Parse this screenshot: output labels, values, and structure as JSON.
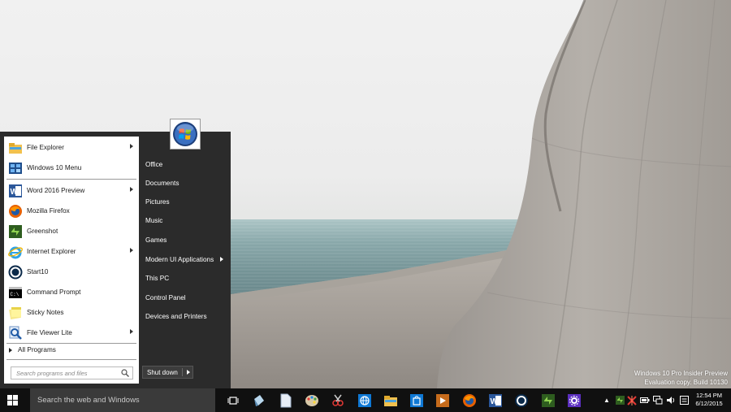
{
  "start_menu": {
    "pinned": [
      {
        "label": "File Explorer",
        "icon": "folder-icon",
        "has_submenu": true
      },
      {
        "label": "Windows 10 Menu",
        "icon": "app-grid-icon",
        "has_submenu": false
      },
      {
        "label": "Word 2016 Preview",
        "icon": "word-icon",
        "has_submenu": true
      },
      {
        "label": "Mozilla Firefox",
        "icon": "firefox-icon",
        "has_submenu": false
      },
      {
        "label": "Greenshot",
        "icon": "greenshot-icon",
        "has_submenu": false
      },
      {
        "label": "Internet Explorer",
        "icon": "ie-icon",
        "has_submenu": true
      },
      {
        "label": "Start10",
        "icon": "start10-icon",
        "has_submenu": false
      },
      {
        "label": "Command Prompt",
        "icon": "cmd-icon",
        "has_submenu": false
      },
      {
        "label": "Sticky Notes",
        "icon": "sticky-notes-icon",
        "has_submenu": false
      },
      {
        "label": "File Viewer Lite",
        "icon": "file-viewer-icon",
        "has_submenu": true
      }
    ],
    "all_programs": "All Programs",
    "search_placeholder": "Search programs and files",
    "right_items": [
      {
        "label": "Office"
      },
      {
        "label": "Documents"
      },
      {
        "label": "Pictures"
      },
      {
        "label": "Music"
      },
      {
        "label": "Games"
      },
      {
        "label": "Modern UI Applications",
        "has_submenu": true
      },
      {
        "label": "This PC"
      },
      {
        "label": "Control Panel"
      },
      {
        "label": "Devices and Printers"
      }
    ],
    "shutdown_label": "Shut down"
  },
  "taskbar": {
    "search_placeholder": "Search the web and Windows",
    "pinned_icons": [
      "task-view-icon",
      "paint-bucket-icon",
      "document-icon",
      "paint-palette-icon",
      "snipping-icon",
      "network-globe-icon",
      "file-explorer-icon",
      "store-icon",
      "media-player-icon",
      "firefox-icon",
      "word-icon",
      "start10-icon",
      "greenshot-icon",
      "settings-icon"
    ],
    "tray_icons": [
      "show-hidden-icon",
      "greenshot-tray-icon",
      "network-error-icon",
      "battery-icon",
      "network-icon",
      "volume-icon",
      "action-center-icon"
    ],
    "time": "12:54 PM",
    "date": "6/12/2015"
  },
  "watermark": {
    "line1": "Windows 10 Pro Insider Preview",
    "line2": "Evaluation copy. Build 10130"
  },
  "colors": {
    "start_dark": "#2b2b2b",
    "taskbar": "#101010",
    "search_bg": "#3a3a3a"
  }
}
